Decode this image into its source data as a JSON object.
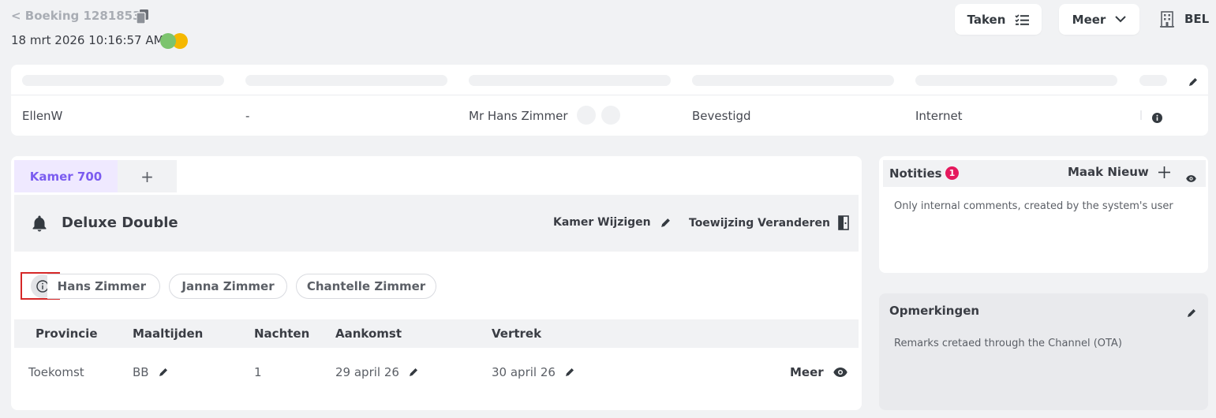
{
  "header": {
    "back_label": "< Boeking 1281853",
    "datetime": "18 mrt 2026 10:16:57 AM",
    "tasks_label": "Taken",
    "more_label": "Meer",
    "property_code": "BEL"
  },
  "summary_row": {
    "user": "EllenW",
    "field2": "-",
    "guest": "Mr Hans Zimmer",
    "status": "Bevestigd",
    "channel": "Internet"
  },
  "room": {
    "tab_active": "Kamer 700",
    "tab_add": "+",
    "type": "Deluxe Double",
    "change_room_label": "Kamer Wijzigen",
    "change_assignment_label": "Toewijzing Veranderen",
    "guests": [
      "Hans Zimmer",
      "Janna Zimmer",
      "Chantelle Zimmer"
    ],
    "table": {
      "headers": [
        "Provincie",
        "Maaltijden",
        "Nachten",
        "Aankomst",
        "Vertrek"
      ],
      "row": {
        "provincie": "Toekomst",
        "maaltijden": "BB",
        "nachten": "1",
        "aankomst": "29 april 26",
        "vertrek": "30 april 26",
        "more": "Meer"
      }
    }
  },
  "notes": {
    "title": "Notities",
    "badge": "1",
    "new_label": "Maak Nieuw",
    "body": "Only internal comments, created by the system's user"
  },
  "remarks": {
    "title": "Opmerkingen",
    "body": "Remarks cretaed through the Channel (OTA)"
  },
  "colors": {
    "accent_purple": "#7b5cf0",
    "tab_bg": "#efe9ff",
    "badge_red": "#e5195d",
    "status_green": "#7cc46e",
    "status_yellow": "#f5b800",
    "highlight_red": "#d62828"
  }
}
